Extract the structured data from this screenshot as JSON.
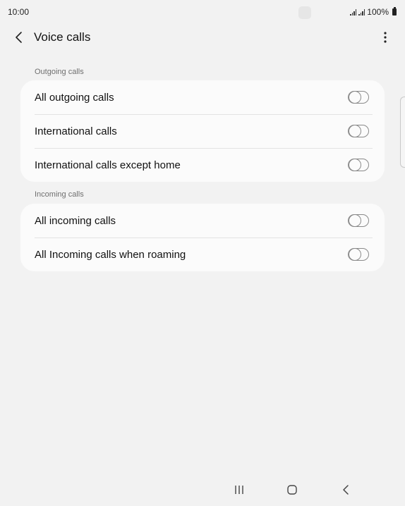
{
  "status_bar": {
    "time": "10:00",
    "battery": "100%"
  },
  "header": {
    "title": "Voice calls",
    "back_icon": "chevron-left-icon",
    "menu_icon": "more-vertical-icon"
  },
  "sections": [
    {
      "header": "Outgoing calls",
      "items": [
        {
          "label": "All outgoing calls",
          "enabled": false
        },
        {
          "label": "International calls",
          "enabled": false
        },
        {
          "label": "International calls except home",
          "enabled": false
        }
      ]
    },
    {
      "header": "Incoming calls",
      "items": [
        {
          "label": "All incoming calls",
          "enabled": false
        },
        {
          "label": "All Incoming calls when roaming",
          "enabled": false
        }
      ]
    }
  ],
  "nav_bar": {
    "recents_icon": "recents-icon",
    "home_icon": "home-icon",
    "back_icon": "back-icon"
  },
  "colors": {
    "background": "#f2f2f2",
    "card": "#fbfbfb",
    "section_text": "#6f6f6f",
    "toggle_off": "#8a8a8a"
  }
}
